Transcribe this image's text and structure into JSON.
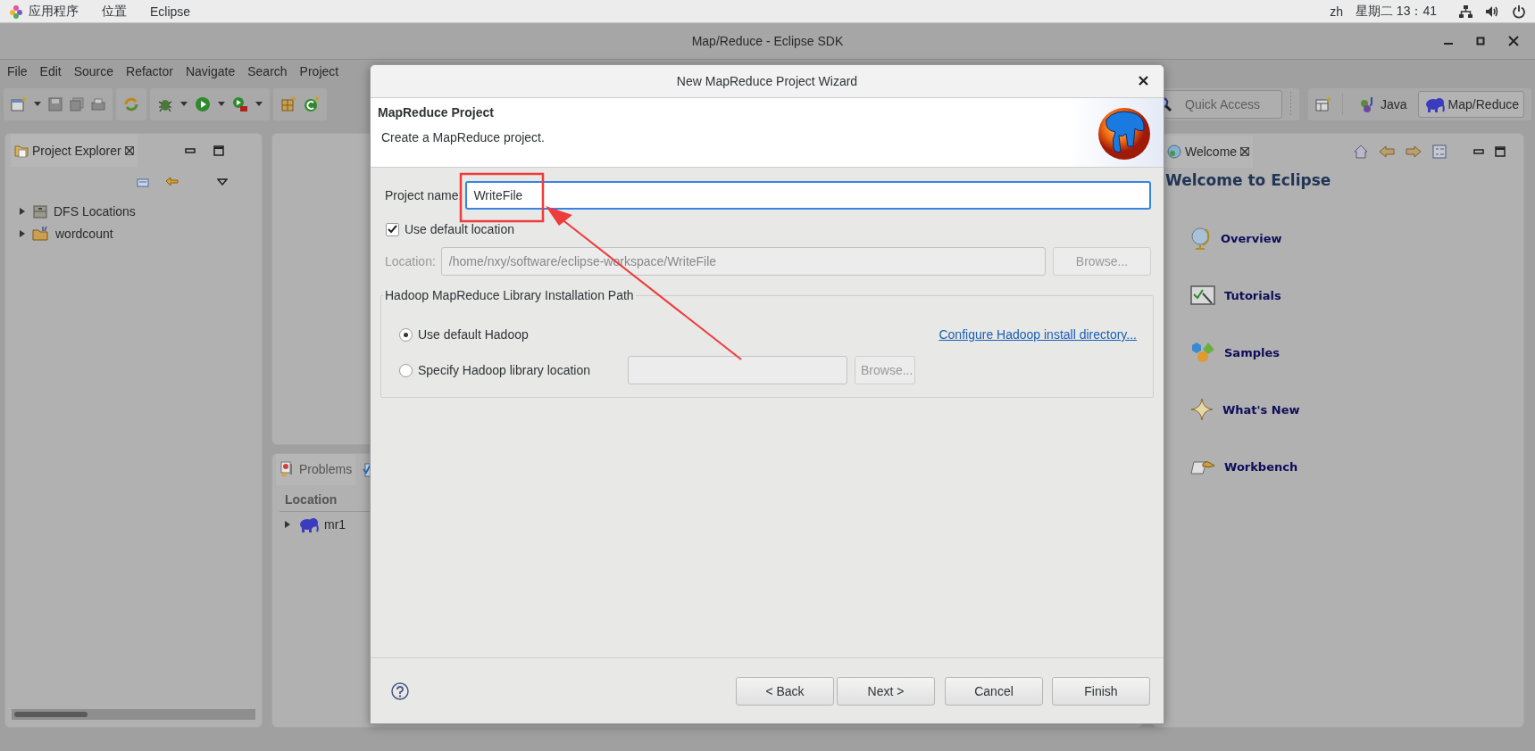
{
  "top_bar": {
    "menus": [
      "应用程序",
      "位置",
      "Eclipse"
    ],
    "language": "zh",
    "clock": "星期二 13：41"
  },
  "window": {
    "title": "Map/Reduce - Eclipse SDK"
  },
  "menu_bar": [
    "File",
    "Edit",
    "Source",
    "Refactor",
    "Navigate",
    "Search",
    "Project"
  ],
  "quick_access": {
    "placeholder": "Quick Access"
  },
  "perspectives": [
    {
      "label": "Java",
      "kind": "java",
      "selected": false
    },
    {
      "label": "Map/Reduce",
      "kind": "mapreduce",
      "selected": true
    }
  ],
  "project_explorer": {
    "title": "Project Explorer",
    "items": [
      {
        "label": "DFS Locations",
        "kind": "locations",
        "expanded": false
      },
      {
        "label": "wordcount",
        "kind": "project",
        "expanded": false
      }
    ]
  },
  "problems_view": {
    "title": "Problems",
    "column": "Location",
    "rows": [
      {
        "label": "mr1",
        "expanded": false
      }
    ]
  },
  "welcome": {
    "tab": "Welcome",
    "heading": "Welcome to Eclipse",
    "links": [
      {
        "label": "Overview",
        "kind": "overview"
      },
      {
        "label": "Tutorials",
        "kind": "tutorials"
      },
      {
        "label": "Samples",
        "kind": "samples"
      },
      {
        "label": "What's New",
        "kind": "whatsnew"
      },
      {
        "label": "Workbench",
        "kind": "workbench"
      }
    ]
  },
  "dialog": {
    "title": "New MapReduce Project Wizard",
    "heading": "MapReduce Project",
    "description": "Create a MapReduce project.",
    "project_name": {
      "label": "Project name:",
      "value": "WriteFile"
    },
    "use_default_location": {
      "label": "Use default location",
      "checked": true
    },
    "location": {
      "label": "Location:",
      "value": "/home/nxy/software/eclipse-workspace/WriteFile",
      "disabled": true
    },
    "location_browse": {
      "label": "Browse...",
      "disabled": true
    },
    "group": {
      "title": "Hadoop MapReduce Library Installation Path",
      "options": [
        {
          "label": "Use default Hadoop",
          "selected": true
        },
        {
          "label": "Specify Hadoop library location",
          "selected": false
        }
      ],
      "link": "Configure Hadoop install directory...",
      "library_browse": {
        "label": "Browse...",
        "disabled": true
      }
    },
    "buttons": [
      "< Back",
      "Next >",
      "Cancel",
      "Finish"
    ]
  }
}
